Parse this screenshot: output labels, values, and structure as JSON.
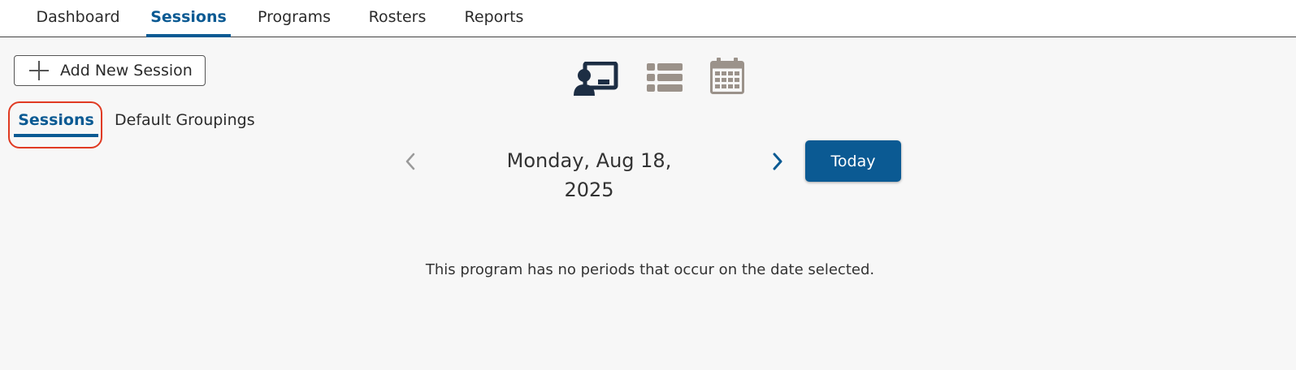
{
  "nav": {
    "tabs": [
      {
        "label": "Dashboard"
      },
      {
        "label": "Sessions"
      },
      {
        "label": "Programs"
      },
      {
        "label": "Rosters"
      },
      {
        "label": "Reports"
      }
    ],
    "active": "Sessions"
  },
  "toolbar": {
    "add_label": "Add New Session",
    "views": [
      "presenter-view-icon",
      "list-view-icon",
      "calendar-view-icon"
    ]
  },
  "subtabs": [
    {
      "label": "Sessions"
    },
    {
      "label": "Default Groupings"
    }
  ],
  "date_nav": {
    "date": "Monday, Aug 18, 2025",
    "today_label": "Today"
  },
  "empty_message": "This program has no periods that occur on the date selected.",
  "colors": {
    "accent": "#0b5a93",
    "icon_dark": "#1d2e44",
    "icon_muted": "#9b928a",
    "highlight": "#e03a22"
  }
}
